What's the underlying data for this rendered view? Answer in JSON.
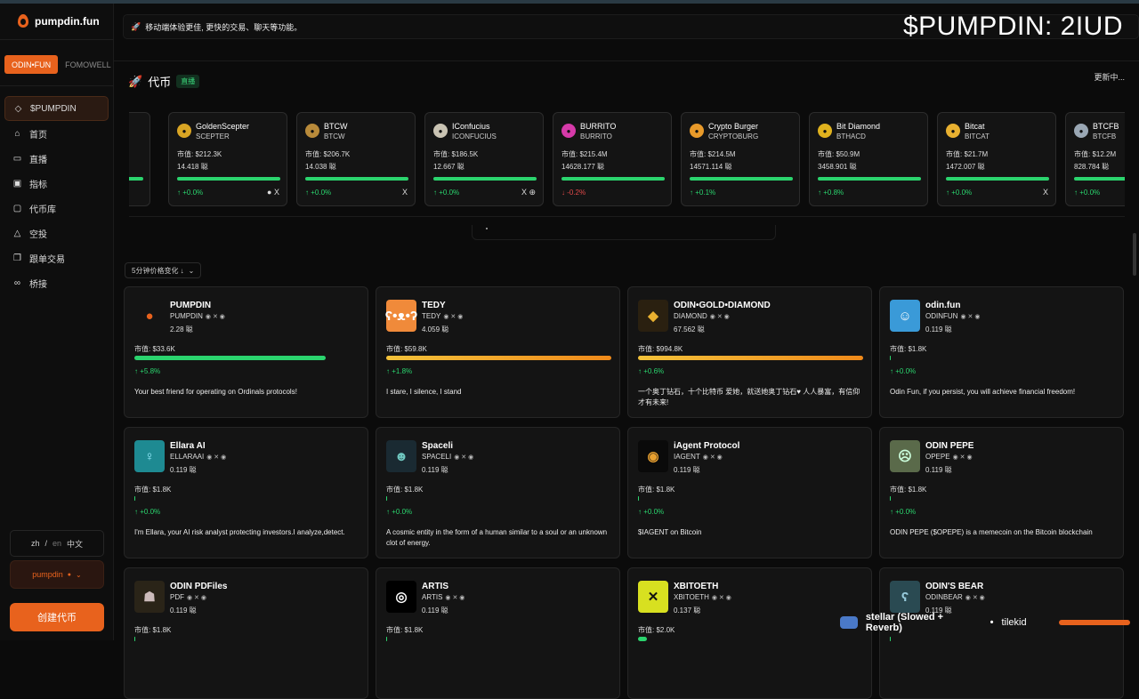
{
  "app": {
    "logo_text": "pumpdin.fun"
  },
  "platform_tabs": [
    "ODIN•FUN",
    "FOMOWELL"
  ],
  "nav": [
    {
      "label": "$PUMPDIN",
      "icon": "diamond-icon"
    },
    {
      "label": "首页",
      "icon": "home-icon"
    },
    {
      "label": "直播",
      "icon": "video-icon"
    },
    {
      "label": "指标",
      "icon": "chart-icon"
    },
    {
      "label": "代币库",
      "icon": "vault-icon"
    },
    {
      "label": "空投",
      "icon": "warning-icon"
    },
    {
      "label": "跟单交易",
      "icon": "copy-icon"
    },
    {
      "label": "桥接",
      "icon": "link-icon"
    }
  ],
  "language": {
    "zh": "zh",
    "sep": "/",
    "en": "en",
    "current": "中文"
  },
  "user_button": "pumpdin",
  "create_button": "创建代币",
  "banner": "移动端体验更佳, 更快的交易、聊天等功能。",
  "overlay_text": "$PUMPDIN: 2IUD",
  "coins": {
    "title": "代币",
    "live": "直播",
    "updating": "更新中..."
  },
  "ticker": [
    {
      "name": "GoldenScepter",
      "ticker": "SCEPTER",
      "mcap": "市值: $212.3K",
      "holders": "14.418 聪",
      "change": "↑ +0.0%",
      "neg": false,
      "social": "● X",
      "color": "#d9a524"
    },
    {
      "name": "BTCW",
      "ticker": "BTCW",
      "mcap": "市值: $206.7K",
      "holders": "14.038 聪",
      "change": "↑ +0.0%",
      "neg": false,
      "social": "X",
      "color": "#b88a3a"
    },
    {
      "name": "IConfucius",
      "ticker": "ICONFUCIUS",
      "mcap": "市值: $186.5K",
      "holders": "12.667 聪",
      "change": "↑ +0.0%",
      "neg": false,
      "social": "X ⊕",
      "color": "#c9c3b3"
    },
    {
      "name": "BURRITO",
      "ticker": "BURRITO",
      "mcap": "市值: $215.4M",
      "holders": "14628.177 聪",
      "change": "↓ -0.2%",
      "neg": true,
      "social": "",
      "color": "#d63aa9"
    },
    {
      "name": "Crypto Burger",
      "ticker": "CRYPTOBURG",
      "mcap": "市值: $214.5M",
      "holders": "14571.114 聪",
      "change": "↑ +0.1%",
      "neg": false,
      "social": "",
      "color": "#e89a2a"
    },
    {
      "name": "Bit Diamond",
      "ticker": "BTHACD",
      "mcap": "市值: $50.9M",
      "holders": "3458.901 聪",
      "change": "↑ +0.8%",
      "neg": false,
      "social": "",
      "color": "#e0b21e"
    },
    {
      "name": "Bitcat",
      "ticker": "BITCAT",
      "mcap": "市值: $21.7M",
      "holders": "1472.007 聪",
      "change": "↑ +0.0%",
      "neg": false,
      "social": "X",
      "color": "#e8b030"
    },
    {
      "name": "BTCFB",
      "ticker": "BTCFB",
      "mcap": "市值: $12.2M",
      "holders": "828.784 聪",
      "change": "↑ +0.0%",
      "neg": false,
      "social": "",
      "color": "#9aa7b4"
    }
  ],
  "sort_label": "5分钟价格变化 ↓",
  "cards": [
    {
      "name": "PUMPDIN",
      "ticker": "PUMPDIN",
      "holders": "2.28 聪",
      "mcap": "市值: $33.6K",
      "change": "↑ +5.8%",
      "progress": 0.85,
      "bar": "#2bd46e",
      "desc": "Your best friend for operating on Ordinals protocols!",
      "icon": "pumpdin-logo",
      "bg": "#141414",
      "fg": "#e8621d",
      "glyph": "●"
    },
    {
      "name": "TEDY",
      "ticker": "TEDY",
      "holders": "4.059 聪",
      "mcap": "市值: $59.8K",
      "change": "↑ +1.8%",
      "progress": 1.0,
      "bar": "#f0a030",
      "desc": "I stare, I silence, I stand",
      "icon": "bear-avatar",
      "bg": "#f08a3a",
      "fg": "#fff",
      "glyph": "ʕ•ᴥ•ʔ"
    },
    {
      "name": "ODIN•GOLD•DIAMOND",
      "ticker": "DIAMOND",
      "holders": "67.562 聪",
      "mcap": "市值: $994.8K",
      "change": "↑ +0.6%",
      "progress": 1.0,
      "bar": "#f0a030",
      "desc": "一个奥丁钻石，十个比特币 爱她，就送她奥丁钻石♥ 人人暴富，有信仰才有未来!",
      "icon": "diamond-avatar",
      "bg": "#2a2010",
      "fg": "#e8b030",
      "glyph": "◆"
    },
    {
      "name": "odin.fun",
      "ticker": "ODINFUN",
      "holders": "0.119 聪",
      "mcap": "市值: $1.8K",
      "change": "↑ +0.0%",
      "progress": 0.0,
      "bar": "#2bd46e",
      "desc": "Odin Fun, if you persist, you will achieve financial freedom!",
      "icon": "odinfun-avatar",
      "bg": "#3a9ad8",
      "fg": "#fff",
      "glyph": "☺"
    },
    {
      "name": "Ellara AI",
      "ticker": "ELLARAAI",
      "holders": "0.119 聪",
      "mcap": "市值: $1.8K",
      "change": "↑ +0.0%",
      "progress": 0.0,
      "bar": "#2bd46e",
      "desc": "I'm Ellara, your AI risk analyst protecting investors.I analyze,detect.",
      "icon": "ellara-avatar",
      "bg": "#1e8a92",
      "fg": "#9ef",
      "glyph": "♀"
    },
    {
      "name": "Spaceli",
      "ticker": "SPACELI",
      "holders": "0.119 聪",
      "mcap": "市值: $1.8K",
      "change": "↑ +0.0%",
      "progress": 0.0,
      "bar": "#2bd46e",
      "desc": "A cosmic entity in the form of a human similar to a soul or an unknown clot of energy.",
      "icon": "spaceli-avatar",
      "bg": "#1a2a32",
      "fg": "#6fc7c0",
      "glyph": "☻"
    },
    {
      "name": "iAgent Protocol",
      "ticker": "IAGENT",
      "holders": "0.119 聪",
      "mcap": "市值: $1.8K",
      "change": "↑ +0.0%",
      "progress": 0.0,
      "bar": "#2bd46e",
      "desc": "$IAGENT on Bitcoin",
      "icon": "iagent-avatar",
      "bg": "#0a0a0a",
      "fg": "#e8a030",
      "glyph": "◉"
    },
    {
      "name": "ODIN PEPE",
      "ticker": "OPEPE",
      "holders": "0.119 聪",
      "mcap": "市值: $1.8K",
      "change": "↑ +0.0%",
      "progress": 0.0,
      "bar": "#2bd46e",
      "desc": "ODIN PEPE ($OPEPE) is a memecoin on the Bitcoin blockchain",
      "icon": "pepe-avatar",
      "bg": "#5a6a4a",
      "fg": "#cfd",
      "glyph": "☹"
    },
    {
      "name": "ODIN PDFiles",
      "ticker": "PDF",
      "holders": "0.119 聪",
      "mcap": "市值: $1.8K",
      "change": "",
      "progress": 0.0,
      "bar": "#2bd46e",
      "desc": "",
      "icon": "pdf-avatar",
      "bg": "#2a2418",
      "fg": "#cbb",
      "glyph": "☗"
    },
    {
      "name": "ARTIS",
      "ticker": "ARTIS",
      "holders": "0.119 聪",
      "mcap": "市值: $1.8K",
      "change": "",
      "progress": 0.0,
      "bar": "#2bd46e",
      "desc": "",
      "icon": "artis-avatar",
      "bg": "#000",
      "fg": "#fff",
      "glyph": "◎"
    },
    {
      "name": "XBITOETH",
      "ticker": "XBITOETH",
      "holders": "0.137 聪",
      "mcap": "市值: $2.0K",
      "change": "",
      "progress": 0.04,
      "bar": "#2bd46e",
      "desc": "",
      "icon": "xbitoeth-avatar",
      "bg": "#d8e020",
      "fg": "#111",
      "glyph": "✕"
    },
    {
      "name": "ODIN'S BEAR",
      "ticker": "ODINBEAR",
      "holders": "0.119 聪",
      "mcap": "",
      "change": "",
      "progress": 0.0,
      "bar": "#2bd46e",
      "desc": "",
      "icon": "bear-avatar-2",
      "bg": "#2a4a52",
      "fg": "#9cd",
      "glyph": "ʕ"
    }
  ],
  "player": {
    "title": "stellar (Slowed + Reverb)",
    "sep": "•",
    "artist": "tilekid"
  }
}
